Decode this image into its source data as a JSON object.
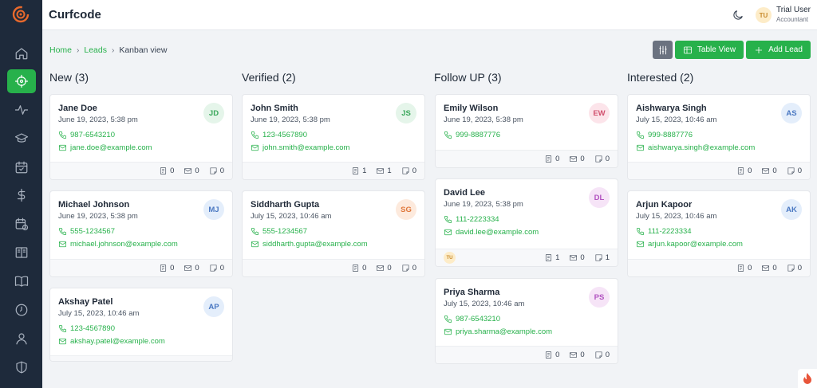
{
  "header": {
    "app_title": "Curfcode",
    "user_initials": "TU",
    "user_name": "Trial User",
    "user_role": "Accountant"
  },
  "sidebar": {
    "items": [
      {
        "icon": "home-icon",
        "active": false
      },
      {
        "icon": "crosshair-icon",
        "active": true
      },
      {
        "icon": "activity-icon",
        "active": false
      },
      {
        "icon": "graduation-cap-icon",
        "active": false
      },
      {
        "icon": "calendar-check-icon",
        "active": false
      },
      {
        "icon": "dollar-icon",
        "active": false
      },
      {
        "icon": "calendar-clock-icon",
        "active": false
      },
      {
        "icon": "book-open-icon",
        "active": false
      },
      {
        "icon": "book-icon",
        "active": false
      },
      {
        "icon": "clock-icon",
        "active": false
      },
      {
        "icon": "user-icon",
        "active": false
      },
      {
        "icon": "shield-icon",
        "active": false
      }
    ]
  },
  "breadcrumb": {
    "home": "Home",
    "leads": "Leads",
    "current": "Kanban view"
  },
  "toolbar": {
    "table_view_label": "Table View",
    "add_lead_label": "Add Lead"
  },
  "colors": {
    "accent": "#27b14b",
    "sidebar": "#1e2a3b"
  },
  "columns": [
    {
      "title": "New (3)",
      "cards": [
        {
          "name": "Jane Doe",
          "date": "June 19, 2023, 5:38 pm",
          "phone": "987-6543210",
          "email": "jane.doe@example.com",
          "initials": "JD",
          "notes": "0",
          "mails": "0",
          "comments": "0"
        },
        {
          "name": "Michael Johnson",
          "date": "June 19, 2023, 5:38 pm",
          "phone": "555-1234567",
          "email": "michael.johnson@example.com",
          "initials": "MJ",
          "notes": "0",
          "mails": "0",
          "comments": "0"
        },
        {
          "name": "Akshay Patel",
          "date": "July 15, 2023, 10:46 am",
          "phone": "123-4567890",
          "email": "akshay.patel@example.com",
          "initials": "AP"
        }
      ]
    },
    {
      "title": "Verified (2)",
      "cards": [
        {
          "name": "John Smith",
          "date": "June 19, 2023, 5:38 pm",
          "phone": "123-4567890",
          "email": "john.smith@example.com",
          "initials": "JS",
          "notes": "1",
          "mails": "1",
          "comments": "0"
        },
        {
          "name": "Siddharth Gupta",
          "date": "July 15, 2023, 10:46 am",
          "phone": "555-1234567",
          "email": "siddharth.gupta@example.com",
          "initials": "SG",
          "notes": "0",
          "mails": "0",
          "comments": "0"
        }
      ]
    },
    {
      "title": "Follow UP (3)",
      "cards": [
        {
          "name": "Emily Wilson",
          "date": "June 19, 2023, 5:38 pm",
          "phone": "999-8887776",
          "initials": "EW",
          "notes": "0",
          "mails": "0",
          "comments": "0"
        },
        {
          "name": "David Lee",
          "date": "June 19, 2023, 5:38 pm",
          "phone": "111-2223334",
          "email": "david.lee@example.com",
          "initials": "DL",
          "owner": "TU",
          "notes": "1",
          "mails": "0",
          "comments": "1"
        },
        {
          "name": "Priya Sharma",
          "date": "July 15, 2023, 10:46 am",
          "phone": "987-6543210",
          "email": "priya.sharma@example.com",
          "initials": "PS",
          "notes": "0",
          "mails": "0",
          "comments": "0"
        }
      ]
    },
    {
      "title": "Interested (2)",
      "cards": [
        {
          "name": "Aishwarya Singh",
          "date": "July 15, 2023, 10:46 am",
          "phone": "999-8887776",
          "email": "aishwarya.singh@example.com",
          "initials": "AS",
          "notes": "0",
          "mails": "0",
          "comments": "0"
        },
        {
          "name": "Arjun Kapoor",
          "date": "July 15, 2023, 10:46 am",
          "phone": "111-2223334",
          "email": "arjun.kapoor@example.com",
          "initials": "AK",
          "notes": "0",
          "mails": "0",
          "comments": "0"
        }
      ]
    }
  ]
}
